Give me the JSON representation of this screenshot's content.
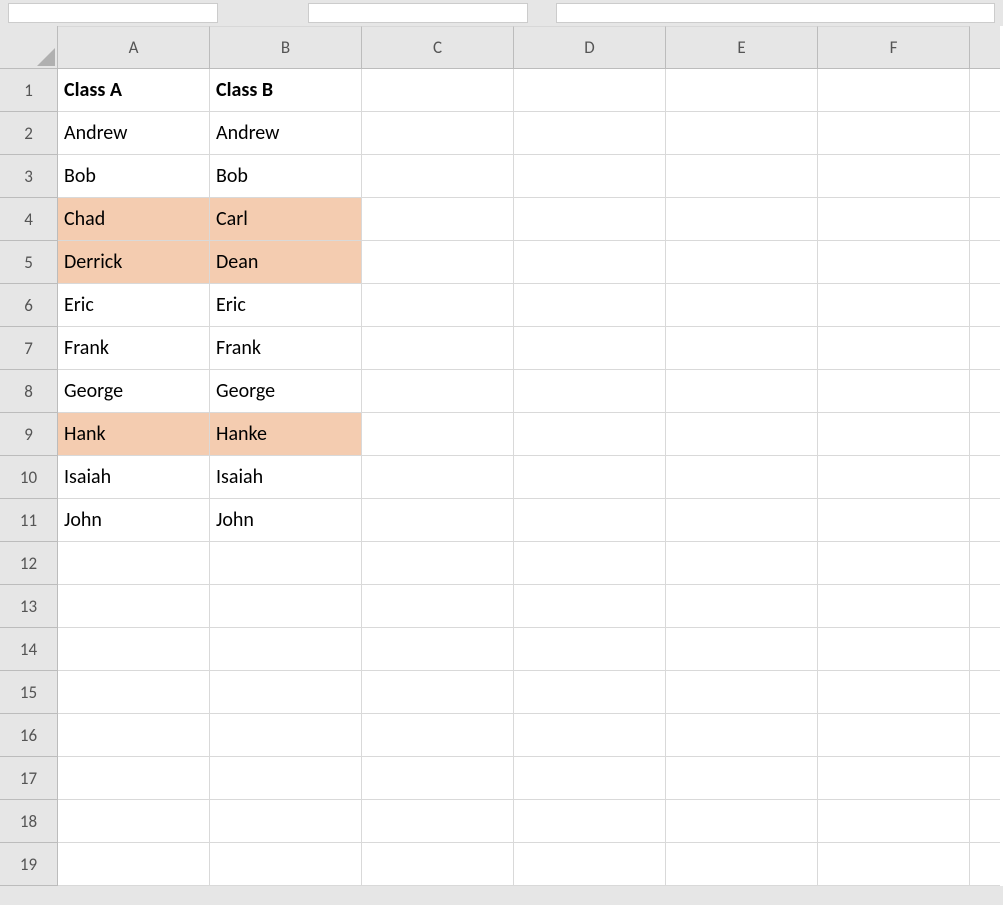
{
  "columns": [
    "A",
    "B",
    "C",
    "D",
    "E",
    "F"
  ],
  "row_count": 19,
  "highlight_color": "#f4ccb0",
  "cells": {
    "A1": {
      "v": "Class A",
      "bold": true
    },
    "B1": {
      "v": "Class B",
      "bold": true
    },
    "A2": {
      "v": "Andrew"
    },
    "B2": {
      "v": "Andrew"
    },
    "A3": {
      "v": "Bob"
    },
    "B3": {
      "v": "Bob"
    },
    "A4": {
      "v": "Chad",
      "highlight": true
    },
    "B4": {
      "v": "Carl",
      "highlight": true
    },
    "A5": {
      "v": "Derrick",
      "highlight": true
    },
    "B5": {
      "v": "Dean",
      "highlight": true
    },
    "A6": {
      "v": "Eric"
    },
    "B6": {
      "v": "Eric"
    },
    "A7": {
      "v": "Frank"
    },
    "B7": {
      "v": "Frank"
    },
    "A8": {
      "v": "George"
    },
    "B8": {
      "v": "George"
    },
    "A9": {
      "v": "Hank",
      "highlight": true
    },
    "B9": {
      "v": "Hanke",
      "highlight": true
    },
    "A10": {
      "v": "Isaiah"
    },
    "B10": {
      "v": "Isaiah"
    },
    "A11": {
      "v": "John"
    },
    "B11": {
      "v": "John"
    }
  }
}
